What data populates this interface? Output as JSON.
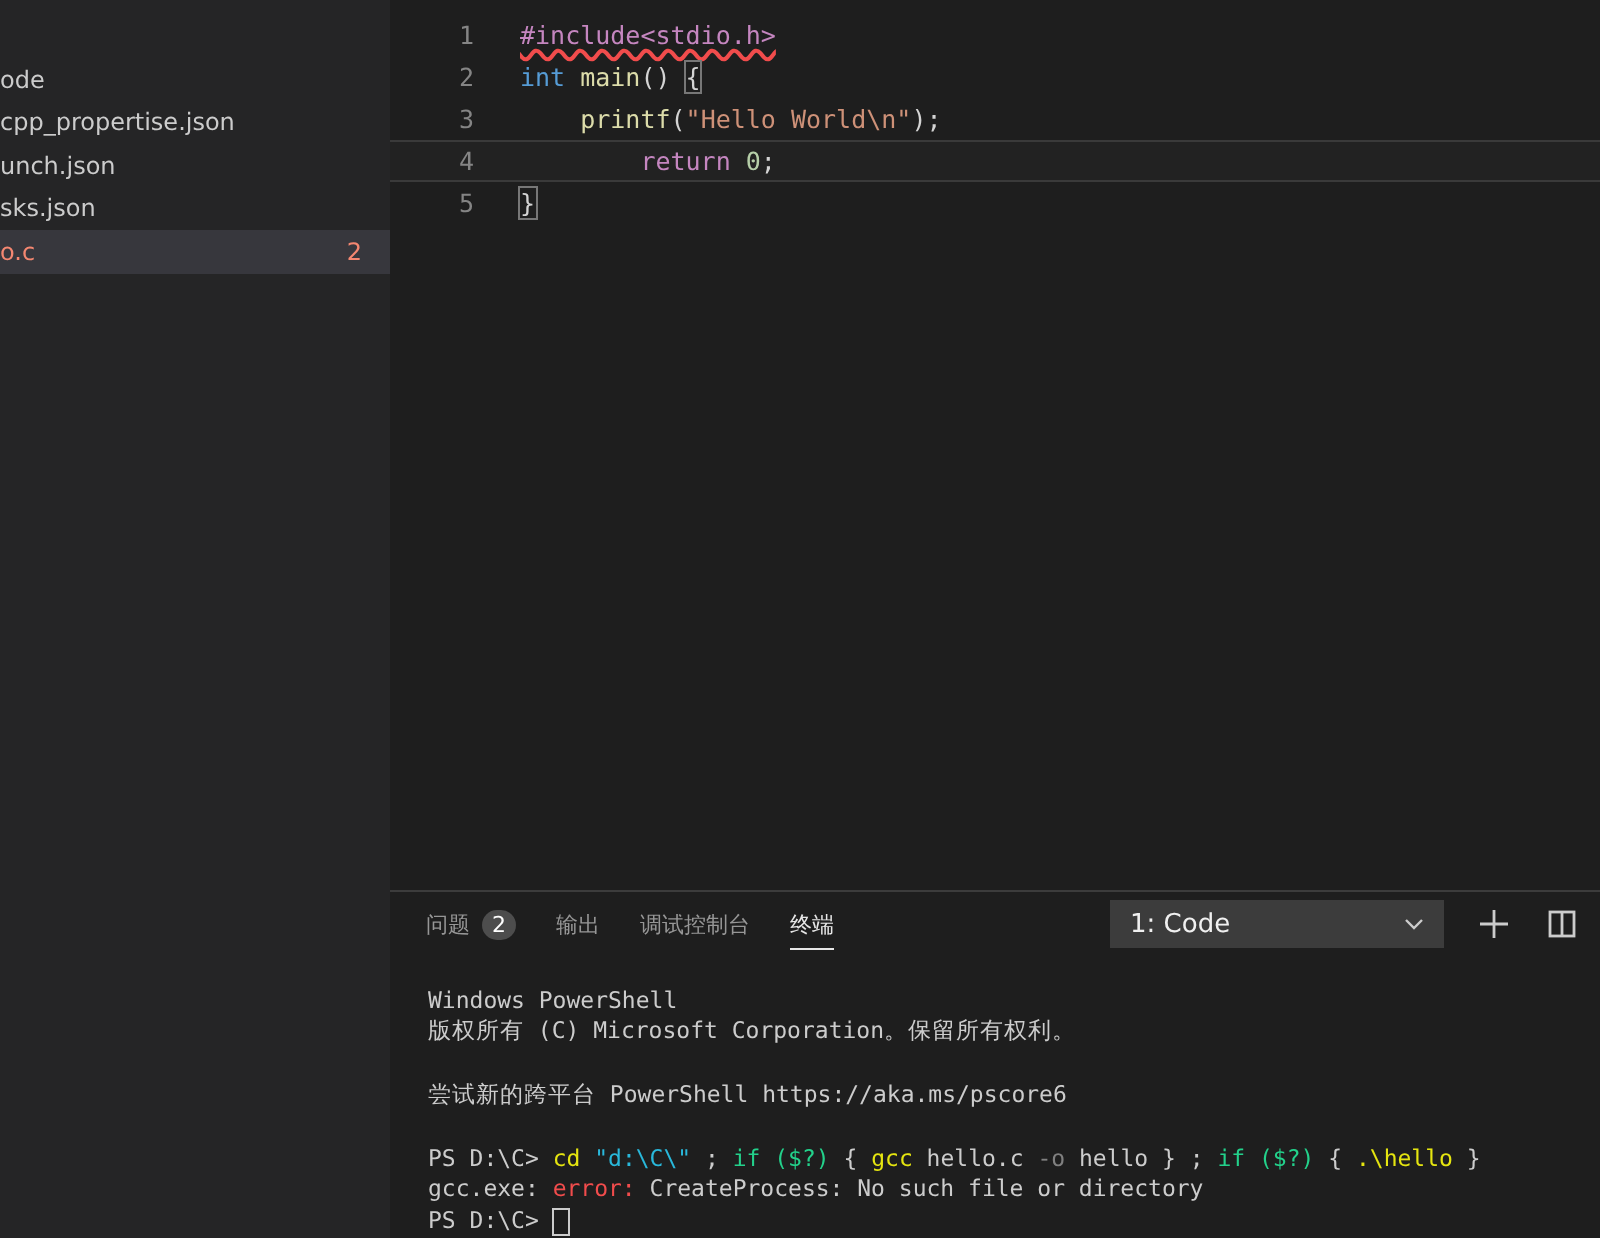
{
  "sidebar": {
    "items": [
      {
        "label": "ode",
        "selected": false
      },
      {
        "label": "cpp_propertise.json",
        "selected": false
      },
      {
        "label": "unch.json",
        "selected": false
      },
      {
        "label": "sks.json",
        "selected": false
      },
      {
        "label": "o.c",
        "selected": true,
        "problem_count": "2"
      }
    ]
  },
  "editor": {
    "lines": [
      {
        "number": "1",
        "current": false,
        "tokens": [
          {
            "kind": "directive",
            "text": "#include<stdio.h>",
            "squiggle": true
          }
        ]
      },
      {
        "number": "2",
        "current": false,
        "tokens": [
          {
            "kind": "type",
            "text": "int"
          },
          {
            "kind": "function",
            "text": " main"
          },
          {
            "kind": "plain",
            "text": "() "
          },
          {
            "kind": "bracket",
            "text": "{"
          }
        ]
      },
      {
        "number": "3",
        "current": false,
        "tokens": [
          {
            "kind": "function",
            "text": "    printf"
          },
          {
            "kind": "plain",
            "text": "("
          },
          {
            "kind": "string",
            "text": "\"Hello World\\n\""
          },
          {
            "kind": "plain",
            "text": ");"
          }
        ]
      },
      {
        "number": "4",
        "current": true,
        "tokens": [
          {
            "kind": "control",
            "text": "        return"
          },
          {
            "kind": "number",
            "text": " 0"
          },
          {
            "kind": "plain",
            "text": ";"
          }
        ]
      },
      {
        "number": "5",
        "current": false,
        "tokens": [
          {
            "kind": "bracket",
            "text": "}"
          }
        ]
      }
    ]
  },
  "panel": {
    "tabs": [
      {
        "label": "问题",
        "selected": false,
        "badge": "2"
      },
      {
        "label": "输出",
        "selected": false
      },
      {
        "label": "调试控制台",
        "selected": false
      },
      {
        "label": "终端",
        "selected": true
      }
    ],
    "terminal_select": {
      "value": "1: Code"
    },
    "terminal": {
      "lines": [
        {
          "kind": "text",
          "segments": [
            {
              "kind": "plain",
              "text": "Windows PowerShell"
            }
          ]
        },
        {
          "kind": "text",
          "segments": [
            {
              "kind": "plain",
              "text": "版权所有 (C) Microsoft Corporation。保留所有权利。"
            }
          ]
        },
        {
          "kind": "blank"
        },
        {
          "kind": "text",
          "segments": [
            {
              "kind": "plain",
              "text": "尝试新的跨平台 PowerShell https://aka.ms/pscore6"
            }
          ]
        },
        {
          "kind": "blank"
        },
        {
          "kind": "text",
          "segments": [
            {
              "kind": "plain",
              "text": "PS D:\\C> "
            },
            {
              "kind": "command",
              "text": "cd"
            },
            {
              "kind": "string",
              "text": " \"d:\\C\\\""
            },
            {
              "kind": "plain",
              "text": " ; "
            },
            {
              "kind": "keyword",
              "text": "if ($?)"
            },
            {
              "kind": "plain",
              "text": " { "
            },
            {
              "kind": "command",
              "text": "gcc"
            },
            {
              "kind": "plain",
              "text": " hello.c "
            },
            {
              "kind": "param",
              "text": "-o"
            },
            {
              "kind": "plain",
              "text": " hello } ; "
            },
            {
              "kind": "keyword",
              "text": "if ($?)"
            },
            {
              "kind": "plain",
              "text": " { "
            },
            {
              "kind": "command",
              "text": ".\\hello"
            },
            {
              "kind": "plain",
              "text": " }"
            }
          ]
        },
        {
          "kind": "text",
          "segments": [
            {
              "kind": "plain",
              "text": "gcc.exe: "
            },
            {
              "kind": "error",
              "text": "error:"
            },
            {
              "kind": "plain",
              "text": " CreateProcess: No such file or directory"
            }
          ]
        },
        {
          "kind": "text",
          "segments": [
            {
              "kind": "plain",
              "text": "PS D:\\C> "
            },
            {
              "kind": "cursor"
            }
          ]
        }
      ]
    }
  }
}
